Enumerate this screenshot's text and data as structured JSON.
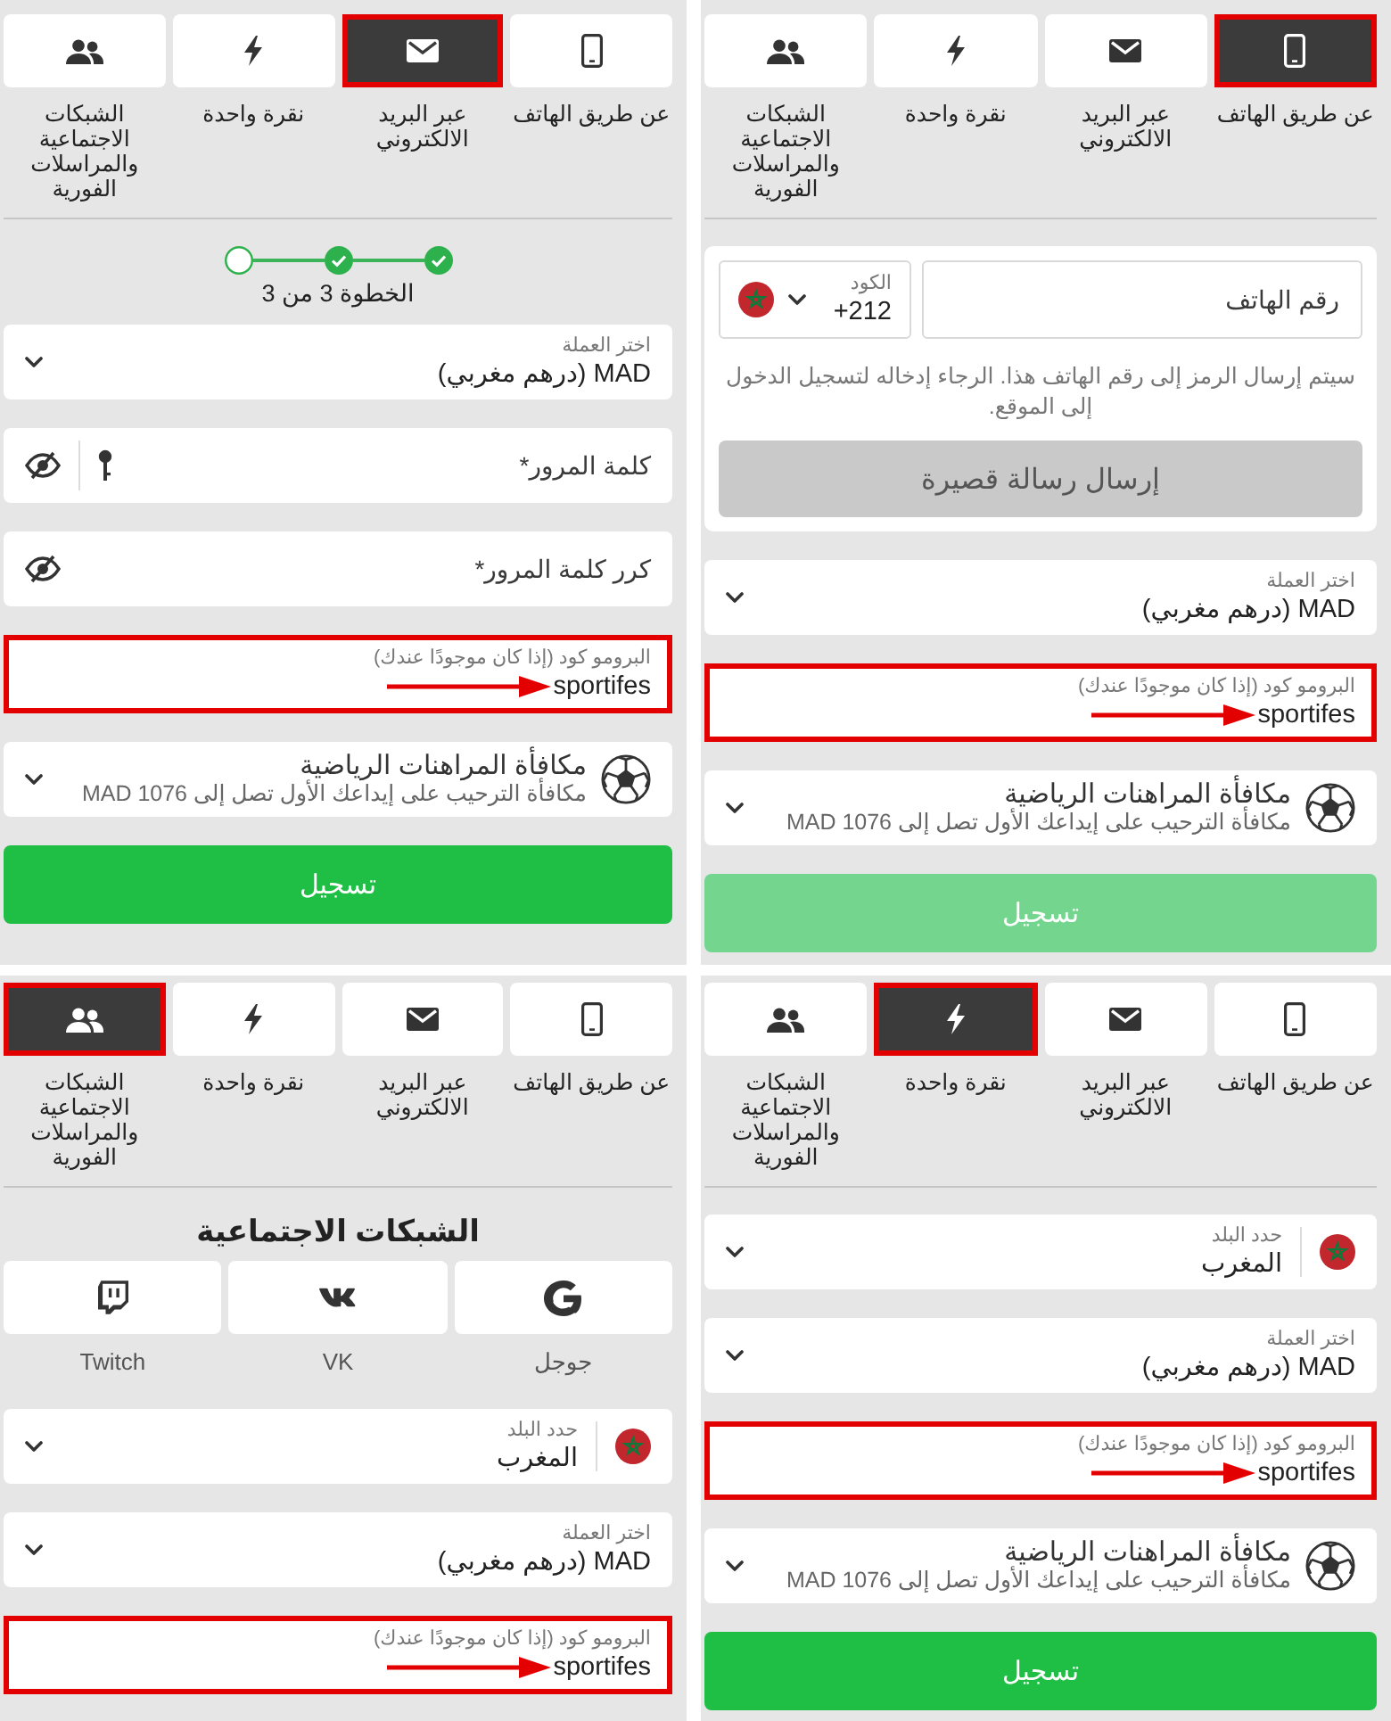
{
  "panels": [
    {
      "tabs": [
        {
          "kind": "phone",
          "label": "عن طريق الهاتف",
          "selected": true
        },
        {
          "kind": "email",
          "label": "عبر البريد الالكتروني",
          "selected": false
        },
        {
          "kind": "click",
          "label": "نقرة واحدة",
          "selected": false
        },
        {
          "kind": "social",
          "label": "الشبكات الاجتماعية والمراسلات الفورية",
          "selected": false
        }
      ],
      "fields": [
        {
          "kind": "phone",
          "placeholder": "رقم الهاتف",
          "code_label": "الكود",
          "code": "+212",
          "note": "سيتم إرسال الرمز إلى رقم الهاتف هذا. الرجاء إدخاله لتسجيل الدخول إلى الموقع.",
          "button": "إرسال رسالة قصيرة"
        },
        {
          "kind": "select",
          "label": "اختر العملة",
          "value": "MAD (درهم مغربي)"
        },
        {
          "kind": "promo",
          "label": "البرومو كود (إذا كان موجودًا عندك)",
          "value": "sportifes",
          "highlighted": true
        },
        {
          "kind": "bonus",
          "title": "مكافأة المراهنات الرياضية",
          "subtitle": "مكافأة الترحيب على إيداعك الأول تصل إلى 1076 MAD"
        },
        {
          "kind": "submit",
          "label": "تسجيل",
          "disabled": true
        }
      ]
    },
    {
      "tabs": [
        {
          "kind": "phone",
          "label": "عن طريق الهاتف",
          "selected": false
        },
        {
          "kind": "email",
          "label": "عبر البريد الالكتروني",
          "selected": true
        },
        {
          "kind": "click",
          "label": "نقرة واحدة",
          "selected": false
        },
        {
          "kind": "social",
          "label": "الشبكات الاجتماعية والمراسلات الفورية",
          "selected": false
        }
      ],
      "fields": [
        {
          "kind": "steps",
          "steps": [
            {
              "completed": true
            },
            {
              "completed": true
            },
            {
              "completed": false
            }
          ],
          "label": "الخطوة 3 من 3"
        },
        {
          "kind": "select",
          "label": "اختر العملة",
          "value": "MAD (درهم مغربي)"
        },
        {
          "kind": "password",
          "placeholder": "كلمة المرور*"
        },
        {
          "kind": "password_confirm",
          "placeholder": "كرر كلمة المرور*"
        },
        {
          "kind": "promo",
          "label": "البرومو كود (إذا كان موجودًا عندك)",
          "value": "sportifes",
          "highlighted": true
        },
        {
          "kind": "bonus",
          "title": "مكافأة المراهنات الرياضية",
          "subtitle": "مكافأة الترحيب على إيداعك الأول تصل إلى 1076 MAD"
        },
        {
          "kind": "submit",
          "label": "تسجيل",
          "disabled": false
        }
      ]
    },
    {
      "tabs": [
        {
          "kind": "phone",
          "label": "عن طريق الهاتف",
          "selected": false
        },
        {
          "kind": "email",
          "label": "عبر البريد الالكتروني",
          "selected": false
        },
        {
          "kind": "click",
          "label": "نقرة واحدة",
          "selected": true
        },
        {
          "kind": "social",
          "label": "الشبكات الاجتماعية والمراسلات الفورية",
          "selected": false
        }
      ],
      "fields": [
        {
          "kind": "country",
          "label": "حدد البلد",
          "value": "المغرب"
        },
        {
          "kind": "select",
          "label": "اختر العملة",
          "value": "MAD (درهم مغربي)"
        },
        {
          "kind": "promo",
          "label": "البرومو كود (إذا كان موجودًا عندك)",
          "value": "sportifes",
          "highlighted": true
        },
        {
          "kind": "bonus",
          "title": "مكافأة المراهنات الرياضية",
          "subtitle": "مكافأة الترحيب على إيداعك الأول تصل إلى 1076 MAD"
        },
        {
          "kind": "submit",
          "label": "تسجيل",
          "disabled": false
        }
      ]
    },
    {
      "tabs": [
        {
          "kind": "phone",
          "label": "عن طريق الهاتف",
          "selected": false
        },
        {
          "kind": "email",
          "label": "عبر البريد الالكتروني",
          "selected": false
        },
        {
          "kind": "click",
          "label": "نقرة واحدة",
          "selected": false
        },
        {
          "kind": "social",
          "label": "الشبكات الاجتماعية والمراسلات الفورية",
          "selected": true
        }
      ],
      "fields": [
        {
          "kind": "social",
          "title": "الشبكات الاجتماعية",
          "networks": [
            {
              "kind": "google",
              "label": "جوجل"
            },
            {
              "kind": "vk",
              "label": "VK"
            },
            {
              "kind": "twitch",
              "label": "Twitch"
            }
          ]
        },
        {
          "kind": "country",
          "label": "حدد البلد",
          "value": "المغرب"
        },
        {
          "kind": "select",
          "label": "اختر العملة",
          "value": "MAD (درهم مغربي)"
        },
        {
          "kind": "promo",
          "label": "البرومو كود (إذا كان موجودًا عندك)",
          "value": "sportifes",
          "highlighted": true
        }
      ]
    }
  ]
}
